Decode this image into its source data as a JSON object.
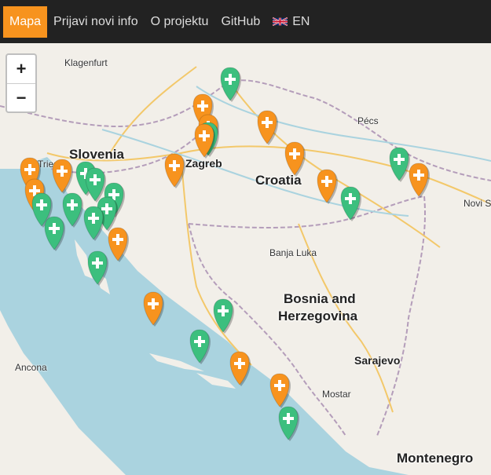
{
  "nav": {
    "items": [
      {
        "label": "Mapa",
        "active": true
      },
      {
        "label": "Prijavi novi info"
      },
      {
        "label": "O projektu"
      },
      {
        "label": "GitHub"
      },
      {
        "label": "EN",
        "icon": "uk-flag-icon"
      }
    ]
  },
  "zoom": {
    "in_label": "+",
    "out_label": "−"
  },
  "map": {
    "colors": {
      "sea": "#aad3df",
      "land": "#f2efe9",
      "border": "#b49dba",
      "highway": "#f3c86a",
      "marker_orange": "#f7931e",
      "marker_green": "#3cbf7e"
    },
    "countries": [
      "Slovenia",
      "Croatia",
      "Bosnia and",
      "Herzegovina",
      "Montenegro"
    ],
    "cities": [
      "Klagenfurt",
      "Pécs",
      "Trieste",
      "Zagreb",
      "Banja Luka",
      "Sarajevo",
      "Mostar",
      "Ancona",
      "Novi S"
    ],
    "markers": [
      {
        "color": "green"
      },
      {
        "color": "green"
      },
      {
        "color": "orange"
      },
      {
        "color": "orange"
      },
      {
        "color": "green"
      },
      {
        "color": "orange"
      },
      {
        "color": "orange"
      },
      {
        "color": "orange"
      },
      {
        "color": "green"
      },
      {
        "color": "orange"
      },
      {
        "color": "orange"
      },
      {
        "color": "orange"
      },
      {
        "color": "green"
      },
      {
        "color": "orange"
      },
      {
        "color": "orange"
      },
      {
        "color": "orange"
      },
      {
        "color": "green"
      },
      {
        "color": "green"
      },
      {
        "color": "green"
      },
      {
        "color": "green"
      },
      {
        "color": "green"
      },
      {
        "color": "green"
      },
      {
        "color": "green"
      },
      {
        "color": "green"
      },
      {
        "color": "orange"
      },
      {
        "color": "green"
      },
      {
        "color": "orange"
      },
      {
        "color": "green"
      },
      {
        "color": "green"
      },
      {
        "color": "orange"
      },
      {
        "color": "orange"
      },
      {
        "color": "green"
      }
    ]
  }
}
